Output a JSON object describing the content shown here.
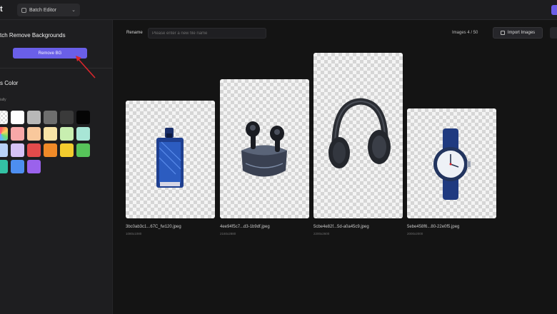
{
  "topbar": {
    "logo_glyph": "t",
    "mode": "Batch Editor",
    "mode_icon": "layers-icon",
    "chevron_icon": "chevron-down-icon"
  },
  "left_panel": {
    "title": "tch Remove Backgrounds",
    "remove_button": "Remove BG",
    "color_section_title": "s Color",
    "swatch_label": "ially",
    "swatches": [
      [
        "transparent",
        "#ffffff",
        "#b8b8b8",
        "#6e6e6e",
        "#3a3a3a",
        "#050505",
        "rainbow"
      ],
      [
        "#f7a8a8",
        "#f9c89c",
        "#f9e4a6",
        "#c8eeb0",
        "#a8e6d6",
        "#b9d2f7",
        "#d6c2f6"
      ],
      [
        "#e34b4b",
        "#f08a28",
        "#f3cc2e",
        "#57c45a",
        "#33c2a4",
        "#4d8ef0",
        "#9a62ec"
      ]
    ]
  },
  "toolbar": {
    "rename_label": "Rename",
    "rename_placeholder": "Please enter a new file name",
    "images_count": "Images  4 / 50",
    "import_label": "Import Images",
    "import_icon": "image-upload-icon"
  },
  "images": [
    {
      "filename": "3bc0ab3c1...67C_fw120.jpeg",
      "dimensions": "1080x1080",
      "subject": "perfume-bottle"
    },
    {
      "filename": "4ee94f5c7...d3-1b9df.jpeg",
      "dimensions": "2160x2880",
      "subject": "earbuds-case"
    },
    {
      "filename": "5cbe4e82f...5d-a0a45c9.jpeg",
      "dimensions": "2200x2600",
      "subject": "headphones"
    },
    {
      "filename": "5ebe458f6...80-22e0f5.jpeg",
      "dimensions": "2000x2000",
      "subject": "wristwatch"
    }
  ],
  "colors": {
    "accent": "#6a5fe8",
    "background": "#141414",
    "panel": "#1e1e20",
    "annotation_arrow": "#d9262c"
  }
}
